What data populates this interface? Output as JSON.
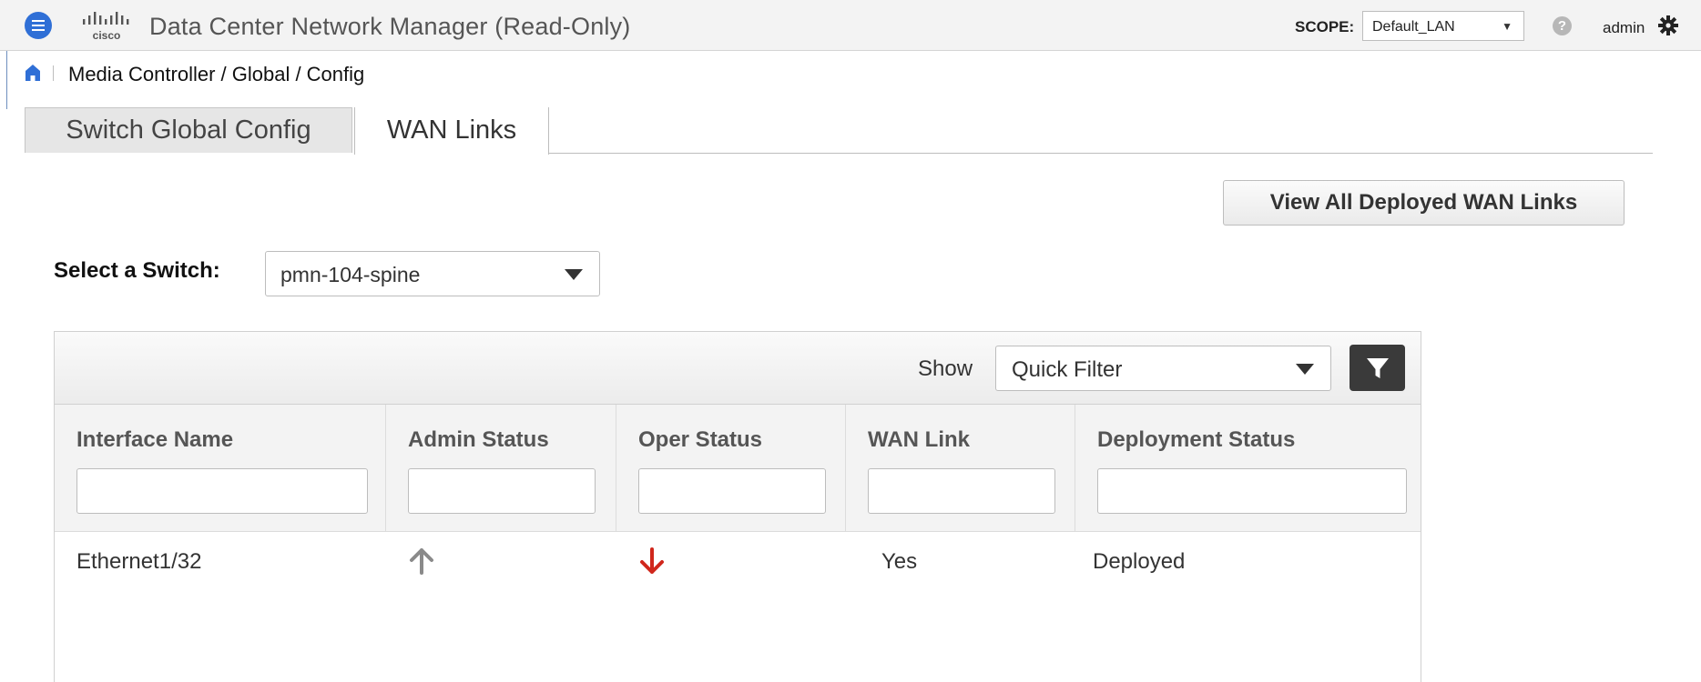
{
  "header": {
    "logo_text": "cisco",
    "app_title": "Data Center Network Manager (Read-Only)",
    "scope_label": "SCOPE:",
    "scope_value": "Default_LAN",
    "user": "admin"
  },
  "breadcrumb": "Media Controller / Global / Config",
  "tabs": [
    {
      "label": "Switch Global Config",
      "active": false
    },
    {
      "label": "WAN Links",
      "active": true
    }
  ],
  "view_all_button": "View All Deployed WAN Links",
  "switch_selector": {
    "label": "Select a Switch:",
    "value": "pmn-104-spine"
  },
  "toolbar": {
    "show_label": "Show",
    "filter_value": "Quick Filter"
  },
  "table": {
    "columns": [
      "Interface Name",
      "Admin Status",
      "Oper Status",
      "WAN Link",
      "Deployment Status"
    ],
    "rows": [
      {
        "interface_name": "Ethernet1/32",
        "admin_status": "up",
        "oper_status": "down",
        "wan_link": "Yes",
        "deployment_status": "Deployed"
      }
    ]
  },
  "colors": {
    "menu_button": "#2f6fd6",
    "admin_up_arrow": "#8a8a8a",
    "oper_down_arrow": "#d0271c",
    "filter_button": "#3a3a3a"
  },
  "icons": {
    "menu": "hamburger-icon",
    "help": "question-icon",
    "settings": "gear-icon",
    "home": "home-icon",
    "filter": "funnel-icon",
    "admin_status": "arrow-up-icon",
    "oper_status": "arrow-down-icon"
  }
}
